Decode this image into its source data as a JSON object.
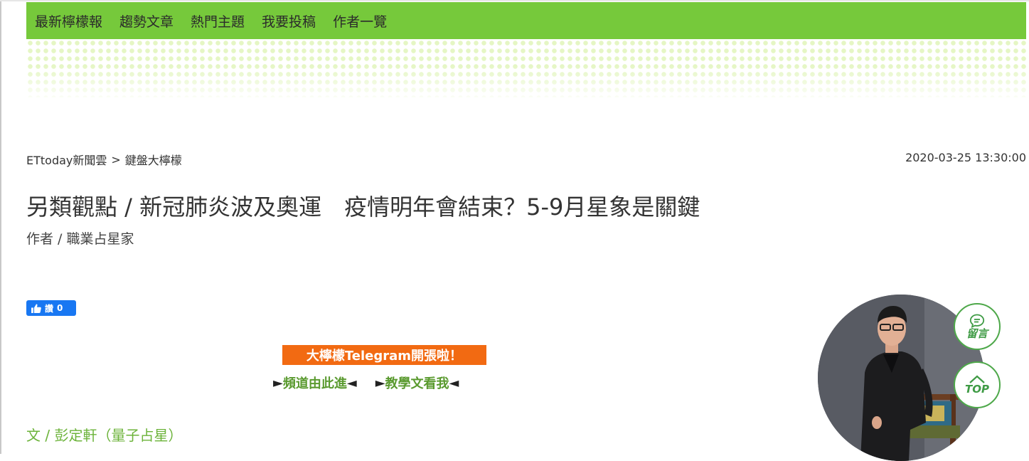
{
  "nav": {
    "items": [
      {
        "label": "最新檸檬報"
      },
      {
        "label": "趨勢文章"
      },
      {
        "label": "熱門主題"
      },
      {
        "label": "我要投稿"
      },
      {
        "label": "作者一覽"
      }
    ]
  },
  "breadcrumb": {
    "root": "ETtoday新聞雲",
    "separator": ">",
    "section": "鍵盤大檸檬"
  },
  "date": "2020-03-25 13:30:00",
  "article": {
    "title": "另類觀點 / 新冠肺炎波及奧運　疫情明年會結束？5-9月星象是關鍵",
    "author": "作者 / 職業占星家",
    "byline": "文 / 彭定軒（量子占星）"
  },
  "like": {
    "label": "讚",
    "count": "0",
    "icon": "thumbs-up-icon"
  },
  "telegram": {
    "banner": "大檸檬Telegram開張啦！",
    "link1": "頻道由此進",
    "link2": "教學文看我",
    "arrow_right": "►",
    "arrow_left": "◄"
  },
  "float_buttons": {
    "comment_label": "留言",
    "top_label": "TOP",
    "comment_icon": "chat-bubble-icon",
    "top_icon": "chevron-up-icon"
  },
  "colors": {
    "nav_bg": "#76c93b",
    "banner_bg": "#f26a12",
    "link_green": "#5a9a2f",
    "byline_green": "#6cb33a",
    "facebook_blue": "#1877f2"
  }
}
